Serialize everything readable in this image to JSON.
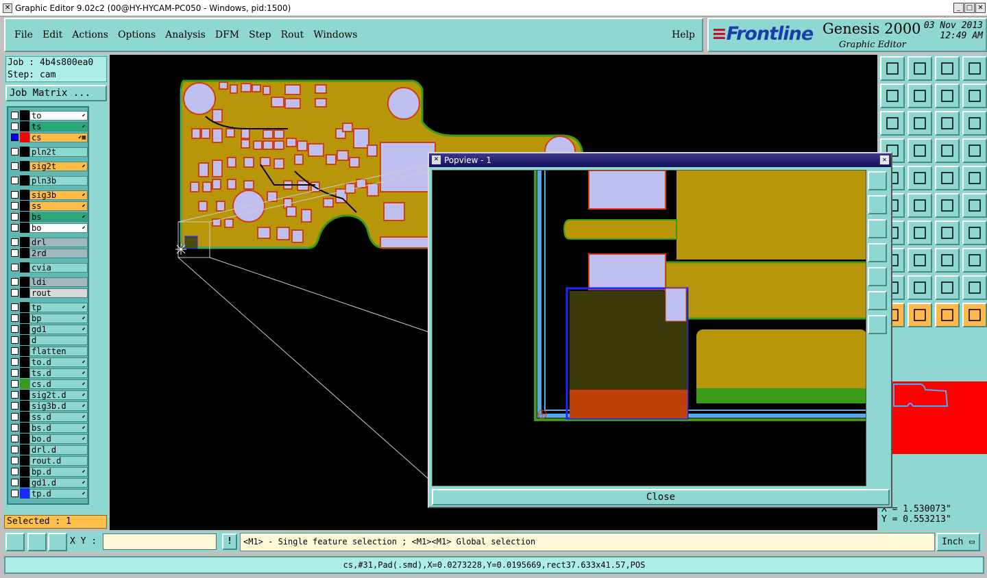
{
  "window": {
    "title": "Graphic Editor 9.02c2 (00@HY-HYCAM-PC050 - Windows, pid:1500)"
  },
  "menu": {
    "items": [
      "File",
      "Edit",
      "Actions",
      "Options",
      "Analysis",
      "DFM",
      "Step",
      "Rout",
      "Windows"
    ],
    "help": "Help"
  },
  "brand": {
    "logo": "Frontline",
    "product": "Genesis 2000",
    "subtitle": "Graphic Editor",
    "date": "03 Nov 2013",
    "time": "12:49 AM"
  },
  "job": {
    "job_label": "Job : 4b4s800ea0",
    "step_label": "Step: cam",
    "matrix_button": "Job Matrix ..."
  },
  "layers": [
    {
      "name": "to",
      "color": "#ffffff",
      "flag": "⬋"
    },
    {
      "name": "ts",
      "color": "#2aa87a",
      "flag": "⬋"
    },
    {
      "name": "cs",
      "color": "#ffbb44",
      "flag": "⬋▦",
      "active": true
    },
    {
      "name": "pln2t",
      "color": "#8fd8d2",
      "flag": ""
    },
    {
      "name": "sig2t",
      "color": "#ffbb44",
      "flag": "⬋"
    },
    {
      "name": "pln3b",
      "color": "#8fd8d2",
      "flag": ""
    },
    {
      "name": "sig3b",
      "color": "#ffbb44",
      "flag": "⬋"
    },
    {
      "name": "ss",
      "color": "#ffbb44",
      "flag": "⬋"
    },
    {
      "name": "bs",
      "color": "#2aa87a",
      "flag": "⬋"
    },
    {
      "name": "bo",
      "color": "#ffffff",
      "flag": "⬋"
    },
    {
      "name": "drl",
      "color": "#a0b8bc",
      "flag": ""
    },
    {
      "name": "2rd",
      "color": "#a0b8bc",
      "flag": ""
    },
    {
      "name": "cvia",
      "color": "#8fd8d2",
      "flag": ""
    },
    {
      "name": "ldi",
      "color": "#a0b8bc",
      "flag": ""
    },
    {
      "name": "rout",
      "color": "#d8d8d8",
      "flag": ""
    },
    {
      "name": "tp",
      "color": "#8fd8d2",
      "flag": "⬋"
    },
    {
      "name": "bp",
      "color": "#8fd8d2",
      "flag": "⬋"
    },
    {
      "name": "gd1",
      "color": "#8fd8d2",
      "flag": "⬋"
    },
    {
      "name": "d",
      "color": "#8fd8d2",
      "flag": ""
    },
    {
      "name": "flatten",
      "color": "#8fd8d2",
      "flag": ""
    },
    {
      "name": "to.d",
      "color": "#8fd8d2",
      "flag": "⬋"
    },
    {
      "name": "ts.d",
      "color": "#8fd8d2",
      "flag": "⬋"
    },
    {
      "name": "cs.d",
      "color": "#8fd8d2",
      "flag": "⬋",
      "swatch": "#3a9a1a"
    },
    {
      "name": "sig2t.d",
      "color": "#8fd8d2",
      "flag": "⬋"
    },
    {
      "name": "sig3b.d",
      "color": "#8fd8d2",
      "flag": "⬋"
    },
    {
      "name": "ss.d",
      "color": "#8fd8d2",
      "flag": "⬋"
    },
    {
      "name": "bs.d",
      "color": "#8fd8d2",
      "flag": "⬋"
    },
    {
      "name": "bo.d",
      "color": "#8fd8d2",
      "flag": "⬋"
    },
    {
      "name": "drl.d",
      "color": "#8fd8d2",
      "flag": ""
    },
    {
      "name": "rout.d",
      "color": "#8fd8d2",
      "flag": ""
    },
    {
      "name": "bp.d",
      "color": "#8fd8d2",
      "flag": "⬋"
    },
    {
      "name": "gd1.d",
      "color": "#8fd8d2",
      "flag": "⬋"
    },
    {
      "name": "tp.d",
      "color": "#8fd8d2",
      "flag": "⬋",
      "swatch": "#1a2aff"
    }
  ],
  "selected": "Selected : 1",
  "popview": {
    "title": "Popview - 1",
    "close_label": "Close"
  },
  "coords": {
    "x": "X = 1.530073\"",
    "y": "Y = 0.553213\""
  },
  "cmd": {
    "xy_label": "X Y :",
    "xy_value": "",
    "message": "<M1> - Single feature selection ; <M1><M1> Global selection",
    "unit": "Inch"
  },
  "status": "cs,#31,Pad(.smd),X=0.0273228,Y=0.0195669,rect37.633x41.57,POS",
  "colors": {
    "board_copper": "#b8960a",
    "pad": "#c0c0f0",
    "pad_outline": "#d04010",
    "substrate": "#3a9a1a",
    "outline": "#5aa8e8"
  }
}
